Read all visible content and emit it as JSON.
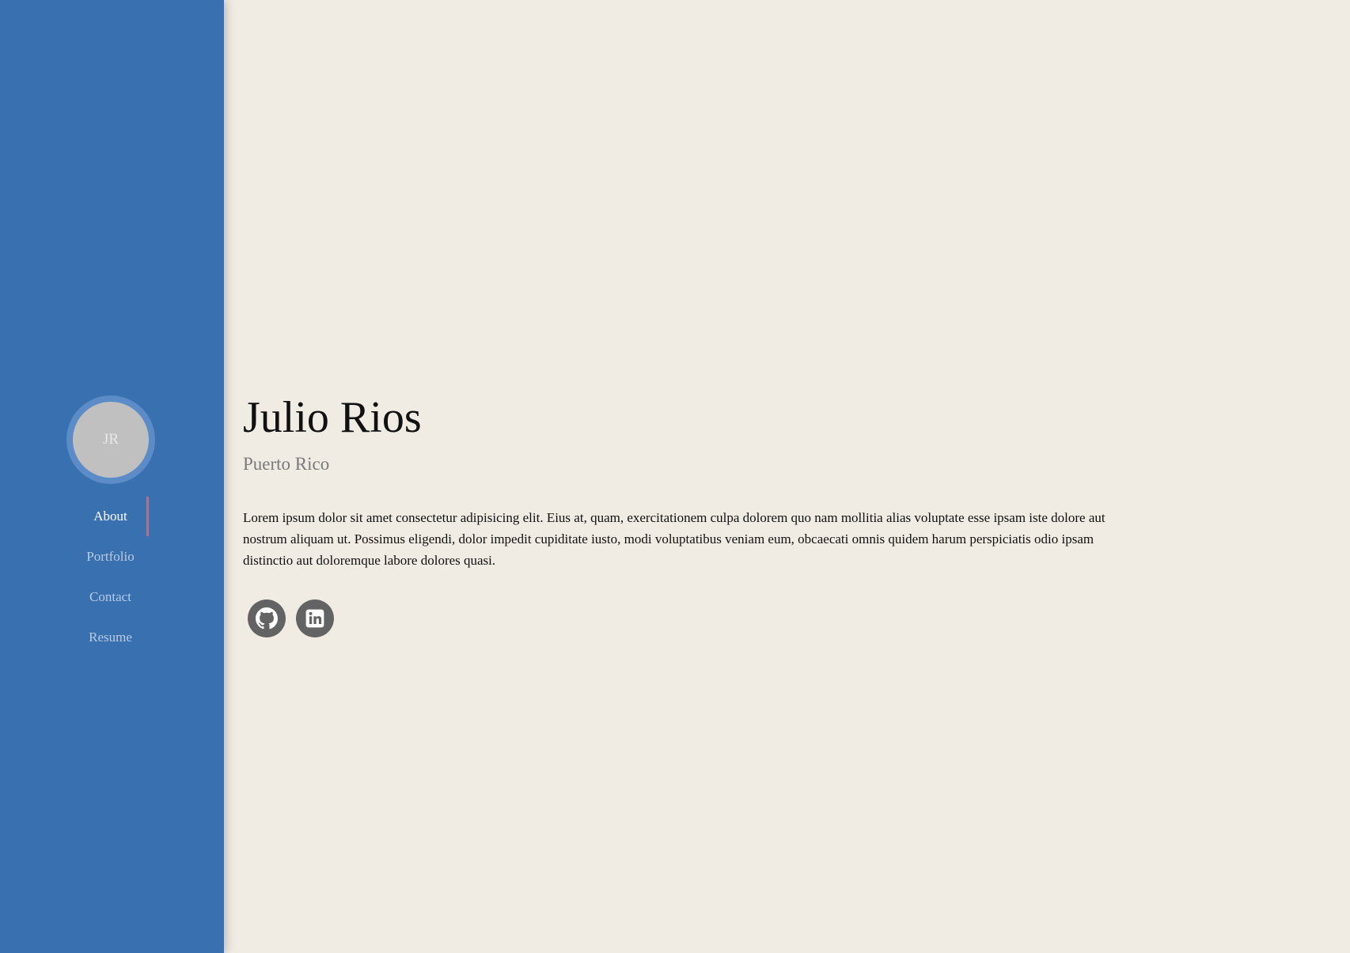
{
  "sidebar": {
    "avatar_initials": "JR",
    "nav": [
      {
        "label": "About",
        "active": true
      },
      {
        "label": "Portfolio",
        "active": false
      },
      {
        "label": "Contact",
        "active": false
      },
      {
        "label": "Resume",
        "active": false
      }
    ]
  },
  "profile": {
    "name": "Julio Rios",
    "location": "Puerto Rico",
    "bio": "Lorem ipsum dolor sit amet consectetur adipisicing elit. Eius at, quam, exercitationem culpa dolorem quo nam mollitia alias voluptate esse ipsam iste dolore aut nostrum aliquam ut. Possimus eligendi, dolor impedit cupiditate iusto, modi voluptatibus veniam eum, obcaecati omnis quidem harum perspiciatis odio ipsam distinctio aut doloremque labore dolores quasi."
  },
  "socials": [
    {
      "icon": "github-icon"
    },
    {
      "icon": "linkedin-icon"
    }
  ],
  "colors": {
    "sidebar_bg": "#3970b0",
    "page_bg": "#f0ebe3",
    "active_indicator": "#e0606a",
    "social_bg": "#636363"
  }
}
